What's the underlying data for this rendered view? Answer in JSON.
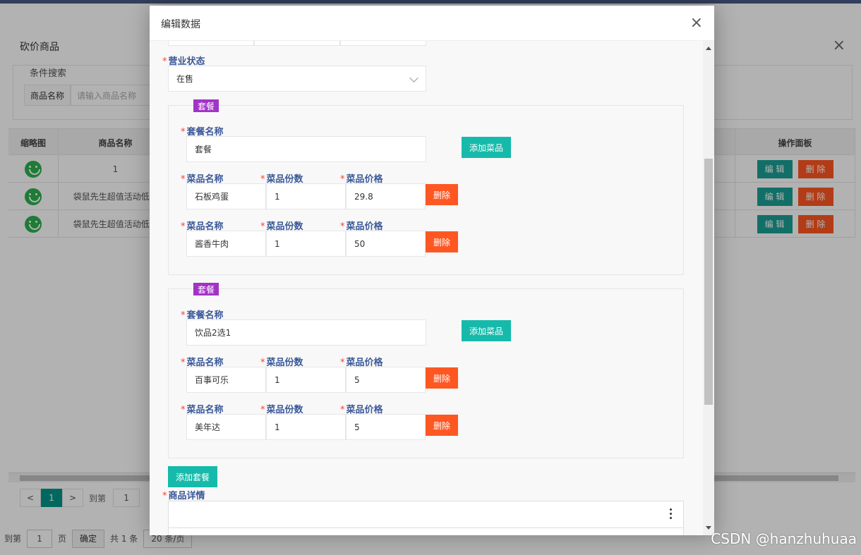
{
  "background": {
    "dialog_title": "砍价商品",
    "search": {
      "legend": "条件搜索",
      "label": "商品名称",
      "placeholder": "请输入商品名称"
    },
    "table": {
      "headers": [
        "缩略图",
        "商品名称",
        "操作面板"
      ],
      "rows": [
        {
          "name": "1"
        },
        {
          "name": "袋鼠先生超值活动低..."
        },
        {
          "name": "袋鼠先生超值活动低..."
        }
      ],
      "edit_label": "编 辑",
      "delete_label": "删 除"
    },
    "pager": {
      "prev": "<",
      "current": "1",
      "next": ">",
      "goto_label": "到第",
      "goto_value": "1"
    },
    "footer": {
      "goto_label": "到第",
      "goto_value": "1",
      "page_label": "页",
      "confirm": "确定",
      "total": "共 1 条",
      "page_size": "20 条/页"
    }
  },
  "modal": {
    "title": "编辑数据",
    "status": {
      "label": "营业状态",
      "value": "在售"
    },
    "sets": [
      {
        "tag": "套餐",
        "name_label": "套餐名称",
        "name_value": "套餐",
        "add_dish": "添加菜品",
        "dishes": [
          {
            "name": "石板鸡蛋",
            "qty": "1",
            "price": "29.8"
          },
          {
            "name": "酱香牛肉",
            "qty": "1",
            "price": "50"
          }
        ]
      },
      {
        "tag": "套餐",
        "name_label": "套餐名称",
        "name_value": "饮品2选1",
        "add_dish": "添加菜品",
        "dishes": [
          {
            "name": "百事可乐",
            "qty": "1",
            "price": "5"
          },
          {
            "name": "美年达",
            "qty": "1",
            "price": "5"
          }
        ]
      }
    ],
    "dish_labels": {
      "name": "菜品名称",
      "qty": "菜品份数",
      "price": "菜品价格"
    },
    "delete_label": "删除",
    "add_set": "添加套餐",
    "detail_label": "商品详情"
  },
  "watermark": "CSDN @hanzhuhuaa"
}
